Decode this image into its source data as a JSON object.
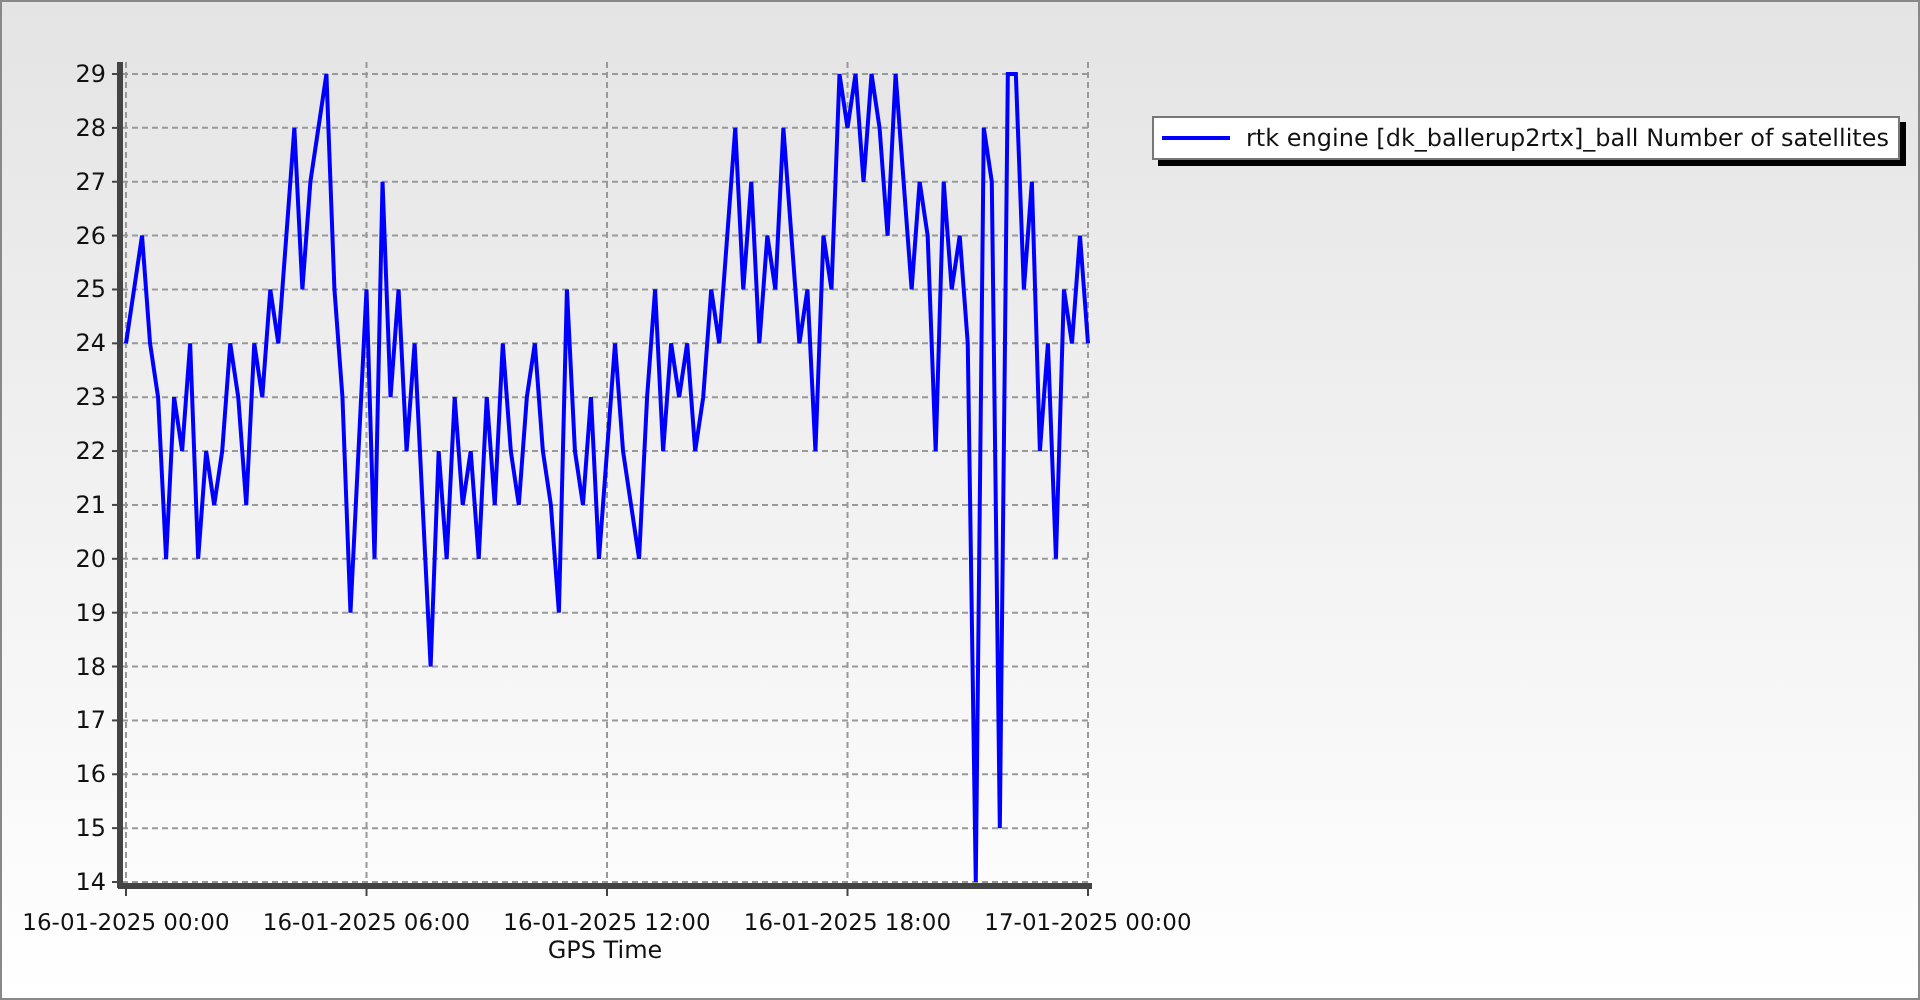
{
  "chart_data": {
    "type": "line",
    "grid": true,
    "xlabel": "GPS Time",
    "categories": [
      "16-01-2025 00:00",
      null,
      null,
      null,
      null,
      null,
      null,
      null,
      null,
      null,
      null,
      null,
      null,
      null,
      null,
      null,
      null,
      null,
      null,
      null,
      null,
      null,
      null,
      null,
      null,
      null,
      null,
      null,
      null,
      null,
      "16-01-2025 06:00",
      null,
      null,
      null,
      null,
      null,
      null,
      null,
      null,
      null,
      null,
      null,
      null,
      null,
      null,
      null,
      null,
      null,
      null,
      null,
      null,
      null,
      null,
      null,
      null,
      null,
      null,
      null,
      null,
      null,
      "16-01-2025 12:00",
      null,
      null,
      null,
      null,
      null,
      null,
      null,
      null,
      null,
      null,
      null,
      null,
      null,
      null,
      null,
      null,
      null,
      null,
      null,
      null,
      null,
      null,
      null,
      null,
      null,
      null,
      null,
      null,
      null,
      "16-01-2025 18:00",
      null,
      null,
      null,
      null,
      null,
      null,
      null,
      null,
      null,
      null,
      null,
      null,
      null,
      null,
      null,
      null,
      null,
      null,
      null,
      null,
      null,
      null,
      null,
      null,
      null,
      null,
      null,
      null,
      null,
      "17-01-2025 00:00"
    ],
    "series": [
      {
        "name": "rtk engine [dk_ballerup2rtx]_ball Number of satellites",
        "color": "#0000ff",
        "values": [
          24,
          25,
          26,
          24,
          23,
          20,
          23,
          22,
          24,
          20,
          22,
          21,
          22,
          24,
          23,
          21,
          24,
          23,
          25,
          24,
          26,
          28,
          25,
          27,
          28,
          29,
          25,
          23,
          19,
          22,
          25,
          20,
          27,
          23,
          25,
          22,
          24,
          21,
          18,
          22,
          20,
          23,
          21,
          22,
          20,
          23,
          21,
          24,
          22,
          21,
          23,
          24,
          22,
          21,
          19,
          25,
          22,
          21,
          23,
          20,
          22,
          24,
          22,
          21,
          20,
          23,
          25,
          22,
          24,
          23,
          24,
          22,
          23,
          25,
          24,
          26,
          28,
          25,
          27,
          24,
          26,
          25,
          28,
          26,
          24,
          25,
          22,
          26,
          25,
          29,
          28,
          29,
          27,
          29,
          28,
          26,
          29,
          27,
          25,
          27,
          26,
          22,
          27,
          25,
          26,
          24,
          14,
          28,
          27,
          15,
          29,
          29,
          25,
          27,
          22,
          24,
          20,
          25,
          24,
          26,
          24
        ]
      }
    ],
    "ylim": [
      14,
      29
    ],
    "yticks": [
      14,
      15,
      16,
      17,
      18,
      19,
      20,
      21,
      22,
      23,
      24,
      25,
      26,
      27,
      28,
      29
    ]
  }
}
